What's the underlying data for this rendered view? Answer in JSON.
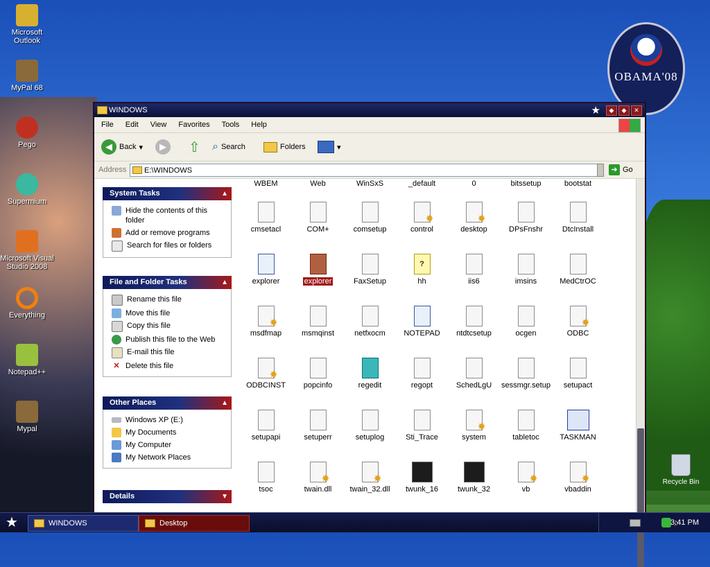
{
  "desktop": {
    "icons": [
      {
        "label": "Microsoft Outlook",
        "color": "#d8b030"
      },
      {
        "label": "MyPal 68",
        "color": "#8a6a3a"
      },
      {
        "label": "Pego",
        "color": "#c03020"
      },
      {
        "label": "Supermium",
        "color": "#3ab8a0"
      },
      {
        "label": "Microsoft Visual Studio 2008",
        "color": "#e07020"
      },
      {
        "label": "Everything",
        "color": "#f08010"
      },
      {
        "label": "Notepad++",
        "color": "#9ac040"
      },
      {
        "label": "Mypal",
        "color": "#8a6a3a"
      }
    ],
    "recycle_bin": "Recycle Bin",
    "badge_text": "OBAMA'08"
  },
  "window": {
    "title": "WINDOWS",
    "menu": [
      "File",
      "Edit",
      "View",
      "Favorites",
      "Tools",
      "Help"
    ],
    "toolbar": {
      "back": "Back",
      "search": "Search",
      "folders": "Folders"
    },
    "address": {
      "label": "Address",
      "value": "E:\\WINDOWS",
      "go": "Go"
    }
  },
  "tasks": {
    "system": {
      "title": "System Tasks",
      "items": [
        "Hide the contents of this folder",
        "Add or remove programs",
        "Search for files or folders"
      ]
    },
    "file_folder": {
      "title": "File and Folder Tasks",
      "items": [
        "Rename this file",
        "Move this file",
        "Copy this file",
        "Publish this file to the Web",
        "E-mail this file",
        "Delete this file"
      ]
    },
    "other": {
      "title": "Other Places",
      "items": [
        "Windows XP (E:)",
        "My Documents",
        "My Computer",
        "My Network Places"
      ]
    },
    "details": {
      "title": "Details"
    }
  },
  "files": {
    "top_row": [
      "WBEM",
      "Web",
      "WinSxS",
      "_default",
      "0",
      "bitssetup",
      "bootstat"
    ],
    "rows": [
      [
        {
          "n": "cmsetacl",
          "t": "txt"
        },
        {
          "n": "COM+",
          "t": "txt"
        },
        {
          "n": "comsetup",
          "t": "txt"
        },
        {
          "n": "control",
          "t": "cfg"
        },
        {
          "n": "desktop",
          "t": "cfg"
        },
        {
          "n": "DPsFnshr",
          "t": "txt"
        },
        {
          "n": "DtcInstall",
          "t": "txt"
        }
      ],
      [
        {
          "n": "explorer",
          "t": "exe"
        },
        {
          "n": "explorer",
          "t": "sel"
        },
        {
          "n": "FaxSetup",
          "t": "txt"
        },
        {
          "n": "hh",
          "t": "help"
        },
        {
          "n": "iis6",
          "t": "txt"
        },
        {
          "n": "imsins",
          "t": "txt"
        },
        {
          "n": "MedCtrOC",
          "t": "txt"
        }
      ],
      [
        {
          "n": "msdfmap",
          "t": "cfg"
        },
        {
          "n": "msmqinst",
          "t": "txt"
        },
        {
          "n": "netfxocm",
          "t": "txt"
        },
        {
          "n": "NOTEPAD",
          "t": "exe"
        },
        {
          "n": "ntdtcsetup",
          "t": "txt"
        },
        {
          "n": "ocgen",
          "t": "txt"
        },
        {
          "n": "ODBC",
          "t": "cfg"
        }
      ],
      [
        {
          "n": "ODBCINST",
          "t": "cfg"
        },
        {
          "n": "popcinfo",
          "t": "txt"
        },
        {
          "n": "regedit",
          "t": "regedit"
        },
        {
          "n": "regopt",
          "t": "txt"
        },
        {
          "n": "SchedLgU",
          "t": "txt"
        },
        {
          "n": "sessmgr.setup",
          "t": "txt"
        },
        {
          "n": "setupact",
          "t": "txt"
        }
      ],
      [
        {
          "n": "setupapi",
          "t": "txt"
        },
        {
          "n": "setuperr",
          "t": "txt"
        },
        {
          "n": "setuplog",
          "t": "txt"
        },
        {
          "n": "Sti_Trace",
          "t": "txt"
        },
        {
          "n": "system",
          "t": "cfg"
        },
        {
          "n": "tabletoc",
          "t": "txt"
        },
        {
          "n": "TASKMAN",
          "t": "taskman"
        }
      ],
      [
        {
          "n": "tsoc",
          "t": "txt"
        },
        {
          "n": "twain.dll",
          "t": "cfg"
        },
        {
          "n": "twain_32.dll",
          "t": "cfg"
        },
        {
          "n": "twunk_16",
          "t": "img"
        },
        {
          "n": "twunk_32",
          "t": "img"
        },
        {
          "n": "vb",
          "t": "cfg"
        },
        {
          "n": "vbaddin",
          "t": "cfg"
        }
      ]
    ],
    "selected": "explorer"
  },
  "taskbar": {
    "tasks": [
      "WINDOWS",
      "Desktop"
    ],
    "clock": "3:41 PM"
  }
}
